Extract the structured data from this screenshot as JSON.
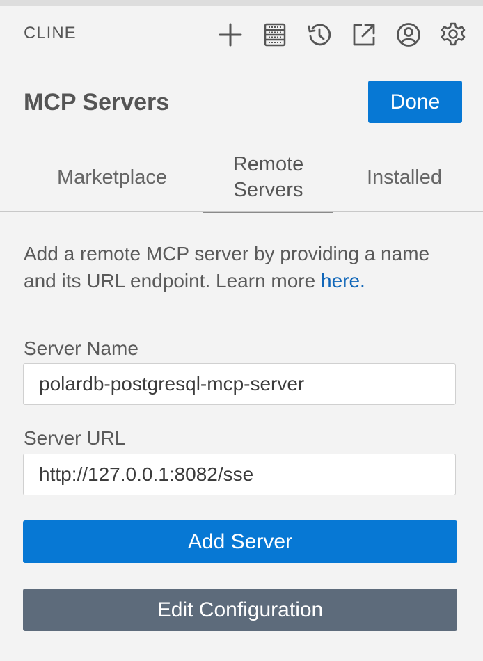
{
  "app": {
    "title": "CLINE"
  },
  "toolbar": {
    "icons": [
      "plus-icon",
      "server-stack-icon",
      "history-icon",
      "external-link-icon",
      "account-icon",
      "gear-icon"
    ]
  },
  "header": {
    "title": "MCP Servers",
    "done_label": "Done"
  },
  "tabs": [
    {
      "label": "Marketplace",
      "active": false
    },
    {
      "label": "Remote\nServers",
      "active": true
    },
    {
      "label": "Installed",
      "active": false
    }
  ],
  "form": {
    "description": "Add a remote MCP server by providing a name and its URL endpoint. Learn more ",
    "learn_more_link": "here.",
    "server_name_label": "Server Name",
    "server_name_value": "polardb-postgresql-mcp-server",
    "server_url_label": "Server URL",
    "server_url_value": "http://127.0.0.1:8082/sse",
    "add_server_label": "Add Server",
    "edit_config_label": "Edit Configuration"
  },
  "colors": {
    "accent": "#0778d4",
    "secondary_button": "#5d6b7b",
    "link": "#1066b8",
    "background": "#f3f3f3"
  }
}
